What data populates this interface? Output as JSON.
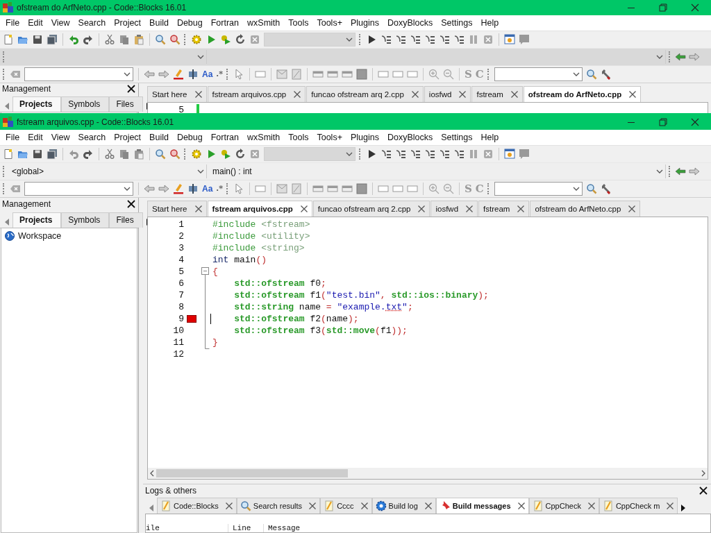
{
  "windows": [
    {
      "title": "ofstream do ArfNeto.cpp - Code::Blocks 16.01",
      "menu": [
        "File",
        "Edit",
        "View",
        "Search",
        "Project",
        "Build",
        "Debug",
        "Fortran",
        "wxSmith",
        "Tools",
        "Tools+",
        "Plugins",
        "DoxyBlocks",
        "Settings",
        "Help"
      ],
      "toolbar": {
        "undo_enabled": true,
        "paste_enabled": true,
        "glyphs": [
          "Aa",
          ".*",
          "S",
          "C"
        ]
      },
      "management": {
        "title": "Management",
        "tabs": [
          {
            "label": "Projects",
            "selected": true
          },
          {
            "label": "Symbols",
            "selected": false
          },
          {
            "label": "Files",
            "selected": false
          }
        ]
      },
      "editor_tabs": [
        {
          "label": "Start here",
          "selected": false
        },
        {
          "label": "fstream arquivos.cpp",
          "selected": false
        },
        {
          "label": "funcao ofstream arq 2.cpp",
          "selected": false
        },
        {
          "label": "iosfwd",
          "selected": false
        },
        {
          "label": "fstream",
          "selected": false
        },
        {
          "label": "ofstream do ArfNeto.cpp",
          "selected": true
        }
      ],
      "editor": {
        "folding": false,
        "lines": [
          {
            "number": "5",
            "breakpoint": false,
            "changed": true,
            "cursor": false
          }
        ]
      }
    },
    {
      "title": "fstream arquivos.cpp - Code::Blocks 16.01",
      "menu": [
        "File",
        "Edit",
        "View",
        "Search",
        "Project",
        "Build",
        "Debug",
        "Fortran",
        "wxSmith",
        "Tools",
        "Tools+",
        "Plugins",
        "DoxyBlocks",
        "Settings",
        "Help"
      ],
      "toolbar": {
        "undo_enabled": false,
        "paste_enabled": false,
        "glyphs": [
          "Aa",
          ".*",
          "S",
          "C"
        ]
      },
      "symbols": {
        "scope": "<global>",
        "function": "main() : int"
      },
      "management": {
        "title": "Management",
        "tabs": [
          {
            "label": "Projects",
            "selected": true
          },
          {
            "label": "Symbols",
            "selected": false
          },
          {
            "label": "Files",
            "selected": false
          }
        ],
        "tree": [
          {
            "label": "Workspace"
          }
        ]
      },
      "editor_tabs": [
        {
          "label": "Start here",
          "selected": false
        },
        {
          "label": "fstream arquivos.cpp",
          "selected": true
        },
        {
          "label": "funcao ofstream arq 2.cpp",
          "selected": false
        },
        {
          "label": "iosfwd",
          "selected": false
        },
        {
          "label": "fstream",
          "selected": false
        },
        {
          "label": "ofstream do ArfNeto.cpp",
          "selected": false
        }
      ],
      "editor": {
        "folding": true,
        "lines": [
          {
            "number": "1",
            "breakpoint": false,
            "changed": false,
            "cursor": false,
            "tokens": [
              {
                "kind": "preproc",
                "text": "#include "
              },
              {
                "kind": "header",
                "text": "<fstream>"
              }
            ]
          },
          {
            "number": "2",
            "breakpoint": false,
            "changed": false,
            "cursor": false,
            "tokens": [
              {
                "kind": "preproc",
                "text": "#include "
              },
              {
                "kind": "header",
                "text": "<utility>"
              }
            ]
          },
          {
            "number": "3",
            "breakpoint": false,
            "changed": false,
            "cursor": false,
            "tokens": [
              {
                "kind": "preproc",
                "text": "#include "
              },
              {
                "kind": "header",
                "text": "<string>"
              }
            ]
          },
          {
            "number": "4",
            "breakpoint": false,
            "changed": false,
            "cursor": false,
            "tokens": [
              {
                "kind": "keyword",
                "text": "int"
              },
              {
                "kind": "ident",
                "text": " main"
              },
              {
                "kind": "op",
                "text": "()"
              }
            ]
          },
          {
            "number": "5",
            "breakpoint": false,
            "changed": false,
            "cursor": false,
            "tokens": [
              {
                "kind": "op",
                "text": "{"
              }
            ]
          },
          {
            "number": "6",
            "breakpoint": false,
            "changed": false,
            "cursor": false,
            "tokens": [
              {
                "kind": "type",
                "text": "    std::ofstream"
              },
              {
                "kind": "ident",
                "text": " f0"
              },
              {
                "kind": "op",
                "text": ";"
              }
            ]
          },
          {
            "number": "7",
            "breakpoint": false,
            "changed": false,
            "cursor": false,
            "tokens": [
              {
                "kind": "type",
                "text": "    std::ofstream"
              },
              {
                "kind": "ident",
                "text": " f1"
              },
              {
                "kind": "op",
                "text": "("
              },
              {
                "kind": "string",
                "text": "\"test.bin\""
              },
              {
                "kind": "op",
                "text": ", "
              },
              {
                "kind": "type",
                "text": "std::ios::binary"
              },
              {
                "kind": "op",
                "text": ");"
              }
            ]
          },
          {
            "number": "8",
            "breakpoint": false,
            "changed": false,
            "cursor": false,
            "tokens": [
              {
                "kind": "type",
                "text": "    std::string"
              },
              {
                "kind": "ident",
                "text": " name "
              },
              {
                "kind": "op",
                "text": "="
              },
              {
                "kind": "string",
                "text": " \"example."
              },
              {
                "kind": "spell",
                "text": "txt"
              },
              {
                "kind": "string",
                "text": "\""
              },
              {
                "kind": "op",
                "text": ";"
              }
            ]
          },
          {
            "number": "9",
            "breakpoint": true,
            "changed": false,
            "cursor": true,
            "tokens": [
              {
                "kind": "type",
                "text": "    std::ofstream"
              },
              {
                "kind": "ident",
                "text": " f2"
              },
              {
                "kind": "op",
                "text": "("
              },
              {
                "kind": "ident",
                "text": "name"
              },
              {
                "kind": "op",
                "text": ");"
              }
            ]
          },
          {
            "number": "10",
            "breakpoint": false,
            "changed": false,
            "cursor": false,
            "tokens": [
              {
                "kind": "type",
                "text": "    std::ofstream"
              },
              {
                "kind": "ident",
                "text": " f3"
              },
              {
                "kind": "op",
                "text": "("
              },
              {
                "kind": "type",
                "text": "std::move"
              },
              {
                "kind": "op",
                "text": "("
              },
              {
                "kind": "ident",
                "text": "f1"
              },
              {
                "kind": "op",
                "text": "));"
              }
            ]
          },
          {
            "number": "11",
            "breakpoint": false,
            "changed": false,
            "cursor": false,
            "tokens": [
              {
                "kind": "op",
                "text": "}"
              }
            ]
          },
          {
            "number": "12",
            "breakpoint": false,
            "changed": false,
            "cursor": false
          }
        ]
      },
      "logs": {
        "title": "Logs & others",
        "tabs": [
          {
            "label": "Code::Blocks",
            "kind": "note",
            "selected": false
          },
          {
            "label": "Search results",
            "kind": "search",
            "selected": false
          },
          {
            "label": "Cccc",
            "kind": "note",
            "selected": false
          },
          {
            "label": "Build log",
            "kind": "build",
            "selected": false
          },
          {
            "label": "Build messages",
            "kind": "pin",
            "selected": true
          },
          {
            "label": "CppCheck",
            "kind": "note",
            "selected": false
          },
          {
            "label": "CppCheck m",
            "kind": "note",
            "selected": false
          }
        ],
        "columns": [
          "ile",
          "Line",
          "Message"
        ]
      }
    }
  ]
}
